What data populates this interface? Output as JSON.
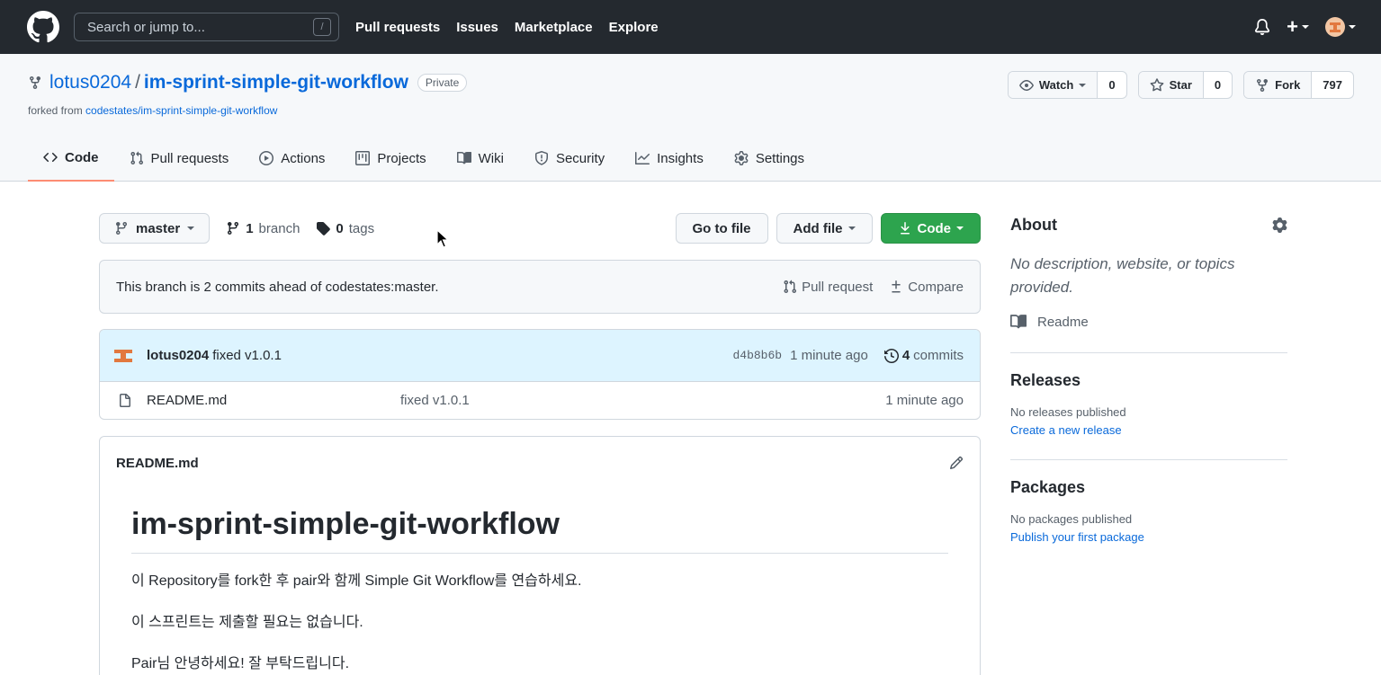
{
  "topbar": {
    "search_placeholder": "Search or jump to...",
    "slash_key": "/",
    "nav": [
      "Pull requests",
      "Issues",
      "Marketplace",
      "Explore"
    ],
    "plus": "+"
  },
  "repo": {
    "owner": "lotus0204",
    "separator": "/",
    "name": "im-sprint-simple-git-workflow",
    "visibility": "Private",
    "forked_prefix": "forked from",
    "forked_source": "codestates/im-sprint-simple-git-workflow",
    "watch_label": "Watch",
    "watch_count": "0",
    "star_label": "Star",
    "star_count": "0",
    "fork_label": "Fork",
    "fork_count": "797"
  },
  "tabs": [
    "Code",
    "Pull requests",
    "Actions",
    "Projects",
    "Wiki",
    "Security",
    "Insights",
    "Settings"
  ],
  "filenav": {
    "branch": "master",
    "branch_count": "1",
    "branch_word": "branch",
    "tag_count": "0",
    "tag_word": "tags",
    "goto_file": "Go to file",
    "add_file": "Add file",
    "code": "Code"
  },
  "ahead": {
    "text": "This branch is 2 commits ahead of codestates:master.",
    "pull_request": "Pull request",
    "compare": "Compare"
  },
  "latest_commit": {
    "author": "lotus0204",
    "message": "fixed v1.0.1",
    "sha": "d4b8b6b",
    "time": "1 minute ago",
    "commit_count": "4",
    "commit_word": "commits"
  },
  "files": [
    {
      "name": "README.md",
      "message": "fixed v1.0.1",
      "time": "1 minute ago"
    }
  ],
  "readme": {
    "filename": "README.md",
    "heading": "im-sprint-simple-git-workflow",
    "paragraphs": [
      "이 Repository를 fork한 후 pair와 함께 Simple Git Workflow를 연습하세요.",
      "이 스프린트는 제출할 필요는 없습니다.",
      "Pair님 안녕하세요! 잘 부탁드립니다."
    ]
  },
  "sidebar": {
    "about_title": "About",
    "about_desc": "No description, website, or topics provided.",
    "readme_link": "Readme",
    "releases_title": "Releases",
    "releases_none": "No releases published",
    "releases_link": "Create a new release",
    "packages_title": "Packages",
    "packages_none": "No packages published",
    "packages_link": "Publish your first package"
  },
  "colors": {
    "header_bg": "#24292f",
    "accent": "#0969da",
    "code_button": "#2da44e",
    "tab_underline": "#fd8c73",
    "commit_row_bg": "#ddf4ff"
  }
}
